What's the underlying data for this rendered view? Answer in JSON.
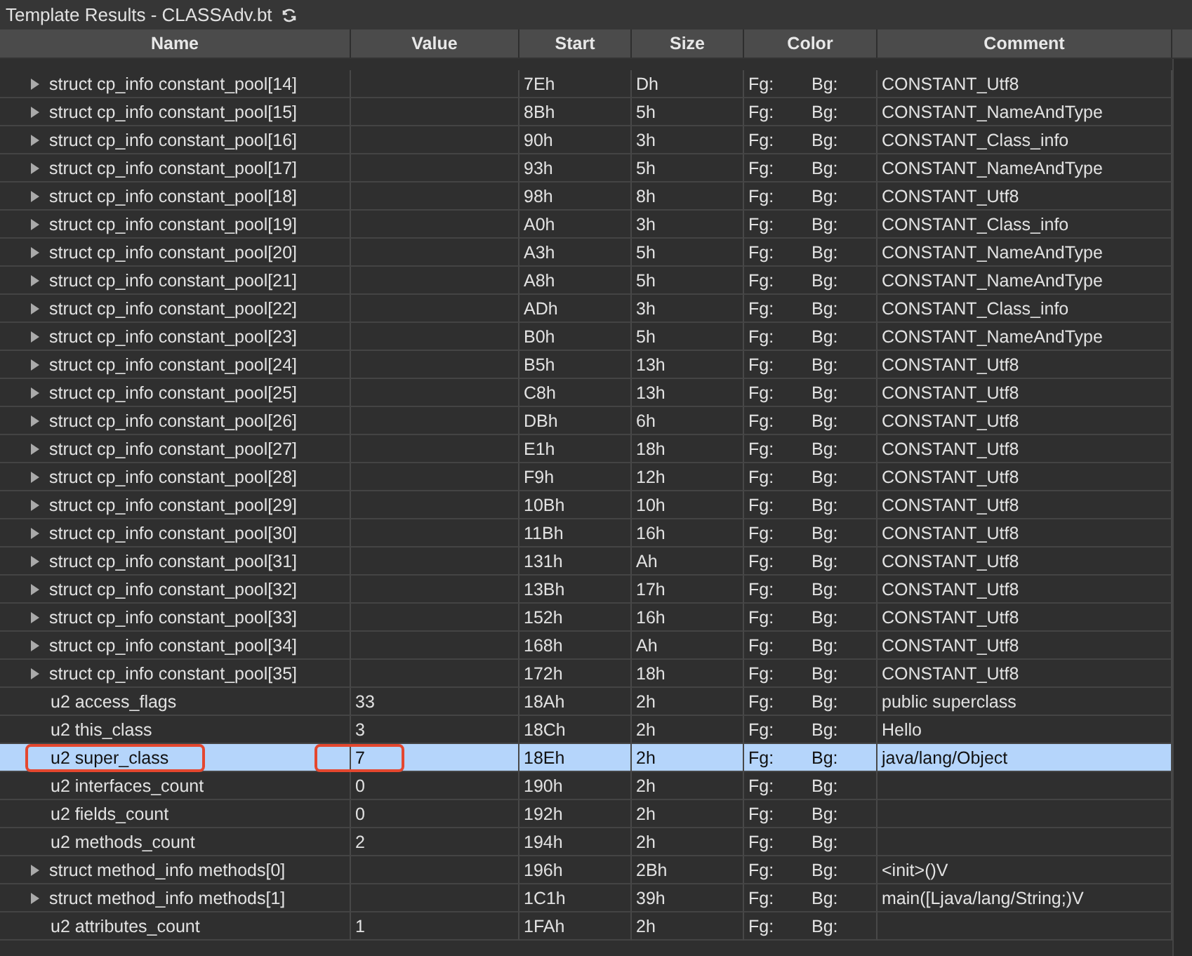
{
  "window": {
    "title": "Template Results - CLASSAdv.bt"
  },
  "columns": [
    "Name",
    "Value",
    "Start",
    "Size",
    "Color",
    "Comment"
  ],
  "rows": [
    {
      "kind": "struct",
      "expanded": false,
      "name": "struct cp_info constant_pool[14]",
      "value": "",
      "start": "7Eh",
      "size": "Dh",
      "fg": "Fg:",
      "bg": "Bg:",
      "comment": "CONSTANT_Utf8",
      "selected": false,
      "circled": false
    },
    {
      "kind": "struct",
      "expanded": false,
      "name": "struct cp_info constant_pool[15]",
      "value": "",
      "start": "8Bh",
      "size": "5h",
      "fg": "Fg:",
      "bg": "Bg:",
      "comment": "CONSTANT_NameAndType",
      "selected": false,
      "circled": false
    },
    {
      "kind": "struct",
      "expanded": false,
      "name": "struct cp_info constant_pool[16]",
      "value": "",
      "start": "90h",
      "size": "3h",
      "fg": "Fg:",
      "bg": "Bg:",
      "comment": "CONSTANT_Class_info",
      "selected": false,
      "circled": false
    },
    {
      "kind": "struct",
      "expanded": false,
      "name": "struct cp_info constant_pool[17]",
      "value": "",
      "start": "93h",
      "size": "5h",
      "fg": "Fg:",
      "bg": "Bg:",
      "comment": "CONSTANT_NameAndType",
      "selected": false,
      "circled": false
    },
    {
      "kind": "struct",
      "expanded": false,
      "name": "struct cp_info constant_pool[18]",
      "value": "",
      "start": "98h",
      "size": "8h",
      "fg": "Fg:",
      "bg": "Bg:",
      "comment": "CONSTANT_Utf8",
      "selected": false,
      "circled": false
    },
    {
      "kind": "struct",
      "expanded": false,
      "name": "struct cp_info constant_pool[19]",
      "value": "",
      "start": "A0h",
      "size": "3h",
      "fg": "Fg:",
      "bg": "Bg:",
      "comment": "CONSTANT_Class_info",
      "selected": false,
      "circled": false
    },
    {
      "kind": "struct",
      "expanded": false,
      "name": "struct cp_info constant_pool[20]",
      "value": "",
      "start": "A3h",
      "size": "5h",
      "fg": "Fg:",
      "bg": "Bg:",
      "comment": "CONSTANT_NameAndType",
      "selected": false,
      "circled": false
    },
    {
      "kind": "struct",
      "expanded": false,
      "name": "struct cp_info constant_pool[21]",
      "value": "",
      "start": "A8h",
      "size": "5h",
      "fg": "Fg:",
      "bg": "Bg:",
      "comment": "CONSTANT_NameAndType",
      "selected": false,
      "circled": false
    },
    {
      "kind": "struct",
      "expanded": false,
      "name": "struct cp_info constant_pool[22]",
      "value": "",
      "start": "ADh",
      "size": "3h",
      "fg": "Fg:",
      "bg": "Bg:",
      "comment": "CONSTANT_Class_info",
      "selected": false,
      "circled": false
    },
    {
      "kind": "struct",
      "expanded": false,
      "name": "struct cp_info constant_pool[23]",
      "value": "",
      "start": "B0h",
      "size": "5h",
      "fg": "Fg:",
      "bg": "Bg:",
      "comment": "CONSTANT_NameAndType",
      "selected": false,
      "circled": false
    },
    {
      "kind": "struct",
      "expanded": false,
      "name": "struct cp_info constant_pool[24]",
      "value": "",
      "start": "B5h",
      "size": "13h",
      "fg": "Fg:",
      "bg": "Bg:",
      "comment": "CONSTANT_Utf8",
      "selected": false,
      "circled": false
    },
    {
      "kind": "struct",
      "expanded": false,
      "name": "struct cp_info constant_pool[25]",
      "value": "",
      "start": "C8h",
      "size": "13h",
      "fg": "Fg:",
      "bg": "Bg:",
      "comment": "CONSTANT_Utf8",
      "selected": false,
      "circled": false
    },
    {
      "kind": "struct",
      "expanded": false,
      "name": "struct cp_info constant_pool[26]",
      "value": "",
      "start": "DBh",
      "size": "6h",
      "fg": "Fg:",
      "bg": "Bg:",
      "comment": "CONSTANT_Utf8",
      "selected": false,
      "circled": false
    },
    {
      "kind": "struct",
      "expanded": false,
      "name": "struct cp_info constant_pool[27]",
      "value": "",
      "start": "E1h",
      "size": "18h",
      "fg": "Fg:",
      "bg": "Bg:",
      "comment": "CONSTANT_Utf8",
      "selected": false,
      "circled": false
    },
    {
      "kind": "struct",
      "expanded": false,
      "name": "struct cp_info constant_pool[28]",
      "value": "",
      "start": "F9h",
      "size": "12h",
      "fg": "Fg:",
      "bg": "Bg:",
      "comment": "CONSTANT_Utf8",
      "selected": false,
      "circled": false
    },
    {
      "kind": "struct",
      "expanded": false,
      "name": "struct cp_info constant_pool[29]",
      "value": "",
      "start": "10Bh",
      "size": "10h",
      "fg": "Fg:",
      "bg": "Bg:",
      "comment": "CONSTANT_Utf8",
      "selected": false,
      "circled": false
    },
    {
      "kind": "struct",
      "expanded": false,
      "name": "struct cp_info constant_pool[30]",
      "value": "",
      "start": "11Bh",
      "size": "16h",
      "fg": "Fg:",
      "bg": "Bg:",
      "comment": "CONSTANT_Utf8",
      "selected": false,
      "circled": false
    },
    {
      "kind": "struct",
      "expanded": false,
      "name": "struct cp_info constant_pool[31]",
      "value": "",
      "start": "131h",
      "size": "Ah",
      "fg": "Fg:",
      "bg": "Bg:",
      "comment": "CONSTANT_Utf8",
      "selected": false,
      "circled": false
    },
    {
      "kind": "struct",
      "expanded": false,
      "name": "struct cp_info constant_pool[32]",
      "value": "",
      "start": "13Bh",
      "size": "17h",
      "fg": "Fg:",
      "bg": "Bg:",
      "comment": "CONSTANT_Utf8",
      "selected": false,
      "circled": false
    },
    {
      "kind": "struct",
      "expanded": false,
      "name": "struct cp_info constant_pool[33]",
      "value": "",
      "start": "152h",
      "size": "16h",
      "fg": "Fg:",
      "bg": "Bg:",
      "comment": "CONSTANT_Utf8",
      "selected": false,
      "circled": false
    },
    {
      "kind": "struct",
      "expanded": false,
      "name": "struct cp_info constant_pool[34]",
      "value": "",
      "start": "168h",
      "size": "Ah",
      "fg": "Fg:",
      "bg": "Bg:",
      "comment": "CONSTANT_Utf8",
      "selected": false,
      "circled": false
    },
    {
      "kind": "struct",
      "expanded": false,
      "name": "struct cp_info constant_pool[35]",
      "value": "",
      "start": "172h",
      "size": "18h",
      "fg": "Fg:",
      "bg": "Bg:",
      "comment": "CONSTANT_Utf8",
      "selected": false,
      "circled": false
    },
    {
      "kind": "field",
      "name": "u2 access_flags",
      "value": "33",
      "start": "18Ah",
      "size": "2h",
      "fg": "Fg:",
      "bg": "Bg:",
      "comment": "public superclass",
      "selected": false,
      "circled": false
    },
    {
      "kind": "field",
      "name": "u2 this_class",
      "value": "3",
      "start": "18Ch",
      "size": "2h",
      "fg": "Fg:",
      "bg": "Bg:",
      "comment": "Hello",
      "selected": false,
      "circled": false
    },
    {
      "kind": "field",
      "name": "u2 super_class",
      "value": "7",
      "start": "18Eh",
      "size": "2h",
      "fg": "Fg:",
      "bg": "Bg:",
      "comment": "java/lang/Object",
      "selected": true,
      "circled": true
    },
    {
      "kind": "field",
      "name": "u2 interfaces_count",
      "value": "0",
      "start": "190h",
      "size": "2h",
      "fg": "Fg:",
      "bg": "Bg:",
      "comment": "",
      "selected": false,
      "circled": false
    },
    {
      "kind": "field",
      "name": "u2 fields_count",
      "value": "0",
      "start": "192h",
      "size": "2h",
      "fg": "Fg:",
      "bg": "Bg:",
      "comment": "",
      "selected": false,
      "circled": false
    },
    {
      "kind": "field",
      "name": "u2 methods_count",
      "value": "2",
      "start": "194h",
      "size": "2h",
      "fg": "Fg:",
      "bg": "Bg:",
      "comment": "",
      "selected": false,
      "circled": false
    },
    {
      "kind": "struct",
      "expanded": false,
      "name": "struct method_info methods[0]",
      "value": "",
      "start": "196h",
      "size": "2Bh",
      "fg": "Fg:",
      "bg": "Bg:",
      "comment": "<init>()V",
      "selected": false,
      "circled": false
    },
    {
      "kind": "struct",
      "expanded": false,
      "name": "struct method_info methods[1]",
      "value": "",
      "start": "1C1h",
      "size": "39h",
      "fg": "Fg:",
      "bg": "Bg:",
      "comment": "main([Ljava/lang/String;)V",
      "selected": false,
      "circled": false
    },
    {
      "kind": "field",
      "name": "u2 attributes_count",
      "value": "1",
      "start": "1FAh",
      "size": "2h",
      "fg": "Fg:",
      "bg": "Bg:",
      "comment": "",
      "selected": false,
      "circled": false
    }
  ]
}
